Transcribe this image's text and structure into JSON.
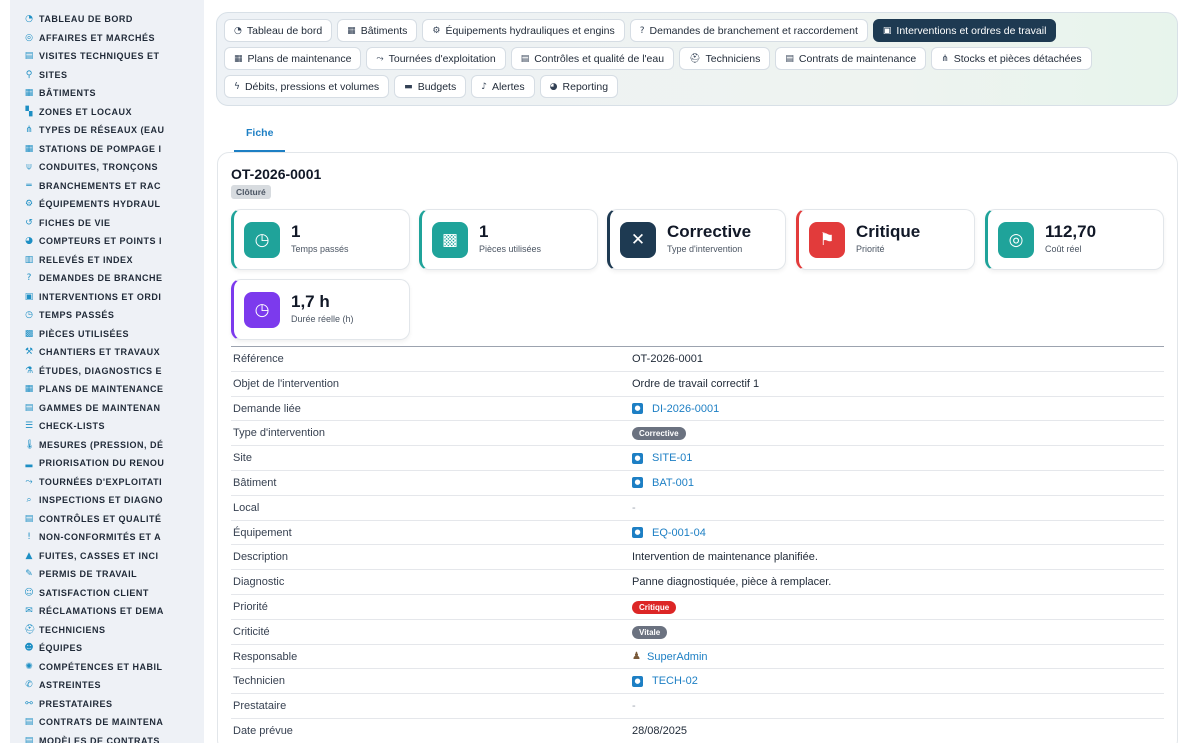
{
  "sidebar": {
    "items": [
      {
        "label": "TABLEAU DE BORD",
        "icon": "dashboard-icon",
        "glyph": "◔"
      },
      {
        "label": "AFFAIRES ET MARCHÉS",
        "icon": "target-icon",
        "glyph": "◎"
      },
      {
        "label": "VISITES TECHNIQUES ET",
        "icon": "clipboard-icon",
        "glyph": "▤"
      },
      {
        "label": "SITES",
        "icon": "map-pin-icon",
        "glyph": "⚲"
      },
      {
        "label": "BÂTIMENTS",
        "icon": "building-icon",
        "glyph": "▦"
      },
      {
        "label": "ZONES ET LOCAUX",
        "icon": "door-icon",
        "glyph": "▚"
      },
      {
        "label": "TYPES DE RÉSEAUX (EAU",
        "icon": "network-icon",
        "glyph": "⋔"
      },
      {
        "label": "STATIONS DE POMPAGE I",
        "icon": "grid-icon",
        "glyph": "▦"
      },
      {
        "label": "CONDUITES, TRONÇONS",
        "icon": "faucet-icon",
        "glyph": "⍦"
      },
      {
        "label": "BRANCHEMENTS ET RAC",
        "icon": "pipe-icon",
        "glyph": "═"
      },
      {
        "label": "ÉQUIPEMENTS HYDRAUL",
        "icon": "gears-icon",
        "glyph": "⚙"
      },
      {
        "label": "FICHES DE VIE",
        "icon": "history-icon",
        "glyph": "↺"
      },
      {
        "label": "COMPTEURS ET POINTS I",
        "icon": "gauge-icon",
        "glyph": "◕"
      },
      {
        "label": "RELEVÉS ET INDEX",
        "icon": "chart-icon",
        "glyph": "▥"
      },
      {
        "label": "DEMANDES DE BRANCHE",
        "icon": "question-icon",
        "glyph": "?"
      },
      {
        "label": "INTERVENTIONS ET ORDI",
        "icon": "clipboard-check-icon",
        "glyph": "▣"
      },
      {
        "label": "TEMPS PASSÉS",
        "icon": "clock-icon",
        "glyph": "◷"
      },
      {
        "label": "PIÈCES UTILISÉES",
        "icon": "boxes-icon",
        "glyph": "▩"
      },
      {
        "label": "CHANTIERS ET TRAVAUX",
        "icon": "hammer-icon",
        "glyph": "⚒"
      },
      {
        "label": "ÉTUDES, DIAGNOSTICS E",
        "icon": "microscope-icon",
        "glyph": "⚗"
      },
      {
        "label": "PLANS DE MAINTENANCE",
        "icon": "calendar-icon",
        "glyph": "▦"
      },
      {
        "label": "GAMMES DE MAINTENAN",
        "icon": "list-box-icon",
        "glyph": "▤"
      },
      {
        "label": "CHECK-LISTS",
        "icon": "checklist-icon",
        "glyph": "☰"
      },
      {
        "label": "MESURES (PRESSION, DÉ",
        "icon": "thermometer-icon",
        "glyph": "🌡"
      },
      {
        "label": "PRIORISATION DU RENOU",
        "icon": "bar-chart-icon",
        "glyph": "▂"
      },
      {
        "label": "TOURNÉES D'EXPLOITATI",
        "icon": "route-icon",
        "glyph": "⤳"
      },
      {
        "label": "INSPECTIONS ET DIAGNO",
        "icon": "search-icon",
        "glyph": "⌕"
      },
      {
        "label": "CONTRÔLES ET QUALITÉ",
        "icon": "clipboard-list-icon",
        "glyph": "▤"
      },
      {
        "label": "NON-CONFORMITÉS ET A",
        "icon": "alert-circle-icon",
        "glyph": "!"
      },
      {
        "label": "FUITES, CASSES ET INCI",
        "icon": "warning-icon",
        "glyph": "▲"
      },
      {
        "label": "PERMIS DE TRAVAIL",
        "icon": "file-signature-icon",
        "glyph": "✎"
      },
      {
        "label": "SATISFACTION CLIENT",
        "icon": "smile-icon",
        "glyph": "☺"
      },
      {
        "label": "RÉCLAMATIONS ET DEMA",
        "icon": "comment-icon",
        "glyph": "✉"
      },
      {
        "label": "TECHNICIENS",
        "icon": "hard-hat-icon",
        "glyph": "⛑"
      },
      {
        "label": "ÉQUIPES",
        "icon": "users-icon",
        "glyph": "☻"
      },
      {
        "label": "COMPÉTENCES ET HABIL",
        "icon": "badge-icon",
        "glyph": "✺"
      },
      {
        "label": "ASTREINTES",
        "icon": "phone-icon",
        "glyph": "✆"
      },
      {
        "label": "PRESTATAIRES",
        "icon": "handshake-icon",
        "glyph": "⚯"
      },
      {
        "label": "CONTRATS DE MAINTENA",
        "icon": "file-contract-icon",
        "glyph": "▤"
      },
      {
        "label": "MODÈLES DE CONTRATS",
        "icon": "file-icon",
        "glyph": "▤"
      }
    ]
  },
  "topnav": {
    "rows": [
      [
        {
          "label": "Tableau de bord",
          "icon": "dashboard-icon",
          "glyph": "◔",
          "active": false
        },
        {
          "label": "Bâtiments",
          "icon": "building-icon",
          "glyph": "▦",
          "active": false
        },
        {
          "label": "Équipements hydrauliques et engins",
          "icon": "gears-icon",
          "glyph": "⚙",
          "active": false
        },
        {
          "label": "Demandes de branchement et raccordement",
          "icon": "question-icon",
          "glyph": "?",
          "active": false
        },
        {
          "label": "Interventions et ordres de travail",
          "icon": "clipboard-check-icon",
          "glyph": "▣",
          "active": true
        }
      ],
      [
        {
          "label": "Plans de maintenance",
          "icon": "calendar-icon",
          "glyph": "▦",
          "active": false
        },
        {
          "label": "Tournées d'exploitation",
          "icon": "route-icon",
          "glyph": "⤳",
          "active": false
        },
        {
          "label": "Contrôles et qualité de l'eau",
          "icon": "clipboard-list-icon",
          "glyph": "▤",
          "active": false
        },
        {
          "label": "Techniciens",
          "icon": "hard-hat-icon",
          "glyph": "⛑",
          "active": false
        },
        {
          "label": "Contrats de maintenance",
          "icon": "file-contract-icon",
          "glyph": "▤",
          "active": false
        },
        {
          "label": "Stocks et pièces détachées",
          "icon": "network-icon",
          "glyph": "⋔",
          "active": false
        }
      ],
      [
        {
          "label": "Débits, pressions et volumes",
          "icon": "bolt-icon",
          "glyph": "ϟ",
          "active": false
        },
        {
          "label": "Budgets",
          "icon": "money-icon",
          "glyph": "▬",
          "active": false
        },
        {
          "label": "Alertes",
          "icon": "bell-icon",
          "glyph": "♪",
          "active": false
        },
        {
          "label": "Reporting",
          "icon": "pie-chart-icon",
          "glyph": "◕",
          "active": false
        }
      ]
    ]
  },
  "tabs": [
    {
      "label": "Fiche"
    }
  ],
  "record": {
    "title": "OT-2026-0001",
    "status": "Clôturé"
  },
  "kpis": [
    {
      "value": "1",
      "label": "Temps passés",
      "icon": "clock-icon",
      "glyph": "◷",
      "color": "#1fa39a"
    },
    {
      "value": "1",
      "label": "Pièces utilisées",
      "icon": "boxes-icon",
      "glyph": "▩",
      "color": "#1fa39a"
    },
    {
      "value": "Corrective",
      "label": "Type d'intervention",
      "icon": "tools-icon",
      "glyph": "✕",
      "color": "#1e3a52"
    },
    {
      "value": "Critique",
      "label": "Priorité",
      "icon": "flag-icon",
      "glyph": "⚑",
      "color": "#e23b3b"
    },
    {
      "value": "112,70",
      "label": "Coût réel",
      "icon": "coins-icon",
      "glyph": "◎",
      "color": "#1fa39a"
    },
    {
      "value": "1,7 h",
      "label": "Durée réelle (h)",
      "icon": "stopwatch-icon",
      "glyph": "◷",
      "color": "#7c3aed"
    }
  ],
  "details": [
    {
      "label": "Référence",
      "value": "OT-2026-0001",
      "kind": "text"
    },
    {
      "label": "Objet de l'intervention",
      "value": "Ordre de travail correctif 1",
      "kind": "text"
    },
    {
      "label": "Demande liée",
      "value": "DI-2026-0001",
      "kind": "link"
    },
    {
      "label": "Type d'intervention",
      "value": "Corrective",
      "kind": "pill-grey"
    },
    {
      "label": "Site",
      "value": "SITE-01",
      "kind": "link"
    },
    {
      "label": "Bâtiment",
      "value": "BAT-001",
      "kind": "link"
    },
    {
      "label": "Local",
      "value": "-",
      "kind": "muted"
    },
    {
      "label": "Équipement",
      "value": "EQ-001-04",
      "kind": "link"
    },
    {
      "label": "Description",
      "value": "Intervention de maintenance planifiée.",
      "kind": "text"
    },
    {
      "label": "Diagnostic",
      "value": "Panne diagnostiquée, pièce à remplacer.",
      "kind": "text"
    },
    {
      "label": "Priorité",
      "value": "Critique",
      "kind": "pill-red"
    },
    {
      "label": "Criticité",
      "value": "Vitale",
      "kind": "pill-grey"
    },
    {
      "label": "Responsable",
      "value": "SuperAdmin",
      "kind": "user"
    },
    {
      "label": "Technicien",
      "value": "TECH-02",
      "kind": "link"
    },
    {
      "label": "Prestataire",
      "value": "-",
      "kind": "muted"
    },
    {
      "label": "Date prévue",
      "value": "28/08/2025",
      "kind": "text"
    }
  ]
}
